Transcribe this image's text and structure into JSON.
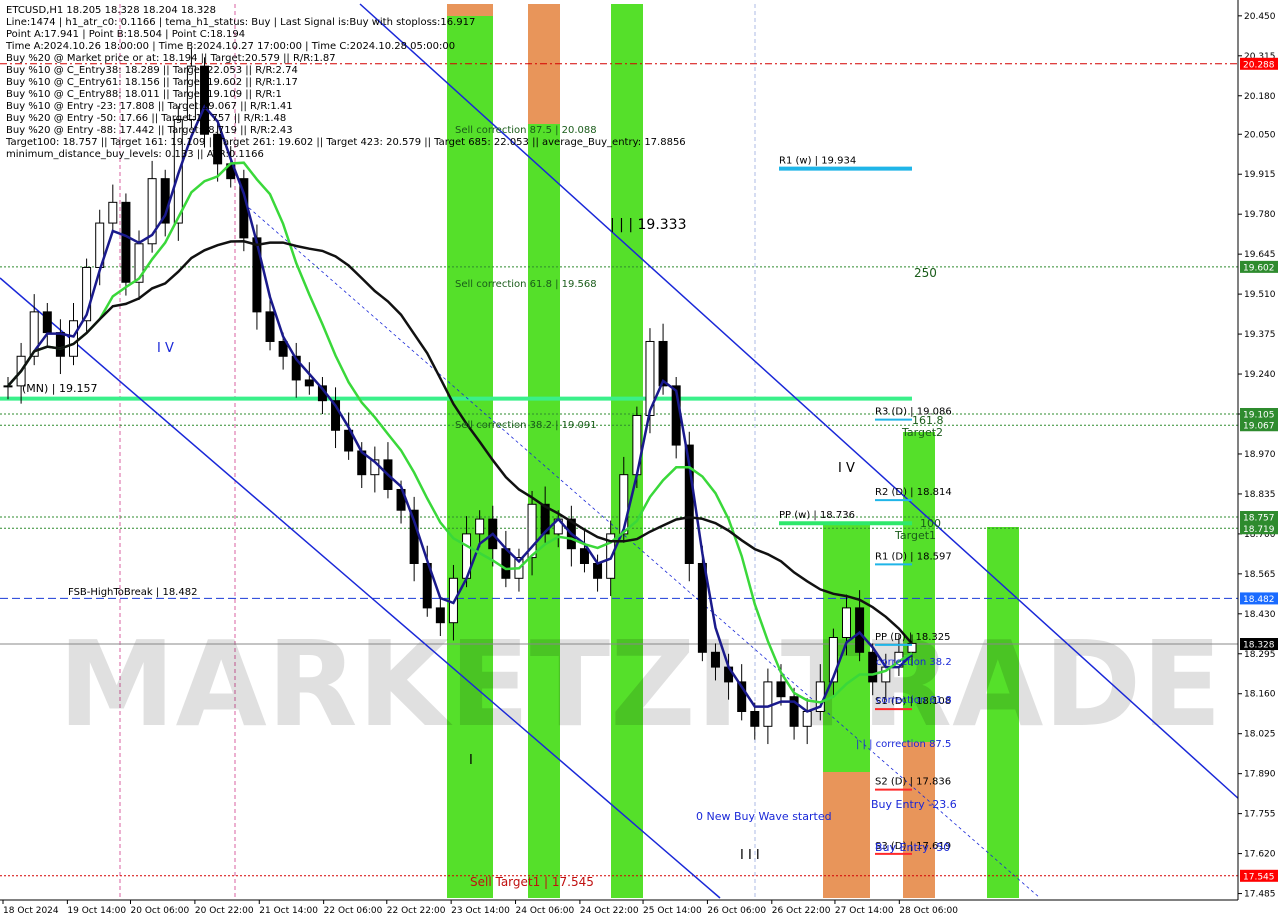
{
  "header": {
    "lines": [
      "ETCUSD,H1  18.205 18.328 18.204 18.328",
      "Line:1474  |  h1_atr_c0: 0.1166  |  tema_h1_status: Buy  |  Last Signal is:Buy with stoploss:16.917",
      "Point A:17.941  |  Point B:18.504  |  Point C:18.194",
      "Time A:2024.10.26 18:00:00  |  Time B:2024.10.27 17:00:00  |  Time C:2024.10.28 05:00:00",
      "Buy %20 @ Market price or at: 18.194  ||  Target:20.579  ||  R/R:1.87",
      "Buy %10 @ C_Entry38: 18.289  ||  Target:22.053  ||  R/R:2.74",
      "Buy %10 @ C_Entry61: 18.156  ||  Target:19.602  ||  R/R:1.17",
      "Buy %10 @ C_Entry88: 18.011  ||  Target:19.109  ||  R/R:1",
      "Buy %10 @ Entry -23: 17.808  ||  Target:19.067  ||  R/R:1.41",
      "Buy %20 @ Entry -50: 17.66  ||  Target:18.757  ||  R/R:1.48",
      "Buy %20 @ Entry -88: 17.442  ||  Target:18.719  ||  R/R:2.43",
      "Target100: 18.757  ||  Target 161: 19.109  ||  Target 261: 19.602  ||  Target 423: 20.579  ||  Target 685: 22.053  ||  average_Buy_entry: 17.8856",
      "minimum_distance_buy_levels: 0.133  ||  ATR:0.1166"
    ]
  },
  "chart_data": {
    "type": "candlestick",
    "symbol": "ETCUSD",
    "timeframe": "H1",
    "ohlc_last": {
      "open": 18.205,
      "high": 18.328,
      "low": 18.204,
      "close": 18.328
    },
    "ylim": [
      17.47,
      20.49
    ],
    "y_ticks": [
      20.45,
      20.315,
      20.18,
      20.05,
      19.915,
      19.78,
      19.645,
      19.51,
      19.375,
      19.24,
      19.105,
      18.97,
      18.835,
      18.7,
      18.565,
      18.43,
      18.295,
      18.16,
      18.025,
      17.89,
      17.755,
      17.62,
      17.485
    ],
    "y_tick_labels": [
      "20.450",
      "20.315",
      "20.180",
      "20.050",
      "19.915",
      "19.780",
      "19.645",
      "19.510",
      "19.375",
      "19.240",
      "19.105",
      "18.970",
      "18.835",
      "18.700",
      "18.565",
      "18.430",
      "18.295",
      "18.160",
      "18.025",
      "17.890",
      "17.755",
      "17.620",
      "17.485"
    ],
    "x_labels": [
      "18 Oct 2024",
      "19 Oct 14:00",
      "20 Oct 06:00",
      "20 Oct 22:00",
      "21 Oct 14:00",
      "22 Oct 06:00",
      "22 Oct 22:00",
      "23 Oct 14:00",
      "24 Oct 06:00",
      "24 Oct 22:00",
      "25 Oct 14:00",
      "26 Oct 06:00",
      "26 Oct 22:00",
      "27 Oct 14:00",
      "28 Oct 06:00"
    ],
    "x_label_frac": [
      0.0,
      0.052,
      0.103,
      0.155,
      0.207,
      0.259,
      0.31,
      0.362,
      0.414,
      0.466,
      0.517,
      0.569,
      0.621,
      0.672,
      0.724
    ],
    "close_series": [
      19.2,
      19.3,
      19.45,
      19.38,
      19.3,
      19.42,
      19.6,
      19.75,
      19.82,
      19.55,
      19.68,
      19.9,
      19.75,
      20.1,
      20.28,
      20.05,
      19.95,
      19.9,
      19.7,
      19.45,
      19.35,
      19.3,
      19.22,
      19.2,
      19.15,
      19.05,
      18.98,
      18.9,
      18.95,
      18.85,
      18.78,
      18.6,
      18.45,
      18.4,
      18.55,
      18.7,
      18.75,
      18.65,
      18.55,
      18.62,
      18.8,
      18.7,
      18.75,
      18.65,
      18.6,
      18.55,
      18.7,
      18.9,
      19.1,
      19.35,
      19.2,
      19.0,
      18.6,
      18.3,
      18.25,
      18.2,
      18.1,
      18.05,
      18.2,
      18.15,
      18.05,
      18.1,
      18.2,
      18.35,
      18.45,
      18.3,
      18.2,
      18.25,
      18.3,
      18.33
    ],
    "price_tags": [
      {
        "value": 20.288,
        "label": "20.288",
        "color": "#ff0000"
      },
      {
        "value": 19.602,
        "label": "19.602",
        "color": "#2e8b2e"
      },
      {
        "value": 19.105,
        "label": "19.105",
        "color": "#2e8b2e"
      },
      {
        "value": 19.067,
        "label": "19.067",
        "color": "#2e8b2e"
      },
      {
        "value": 18.757,
        "label": "18.757",
        "color": "#2e8b2e"
      },
      {
        "value": 18.719,
        "label": "18.719",
        "color": "#2e8b2e"
      },
      {
        "value": 18.482,
        "label": "18.482",
        "color": "#1a6bff"
      },
      {
        "value": 18.328,
        "label": "18.328",
        "color": "#000000"
      },
      {
        "value": 17.545,
        "label": "17.545",
        "color": "#ff0000"
      }
    ],
    "pivots": [
      {
        "label": "R1 (w) | 19.934",
        "value": 19.934,
        "color": "#1fb5e8"
      },
      {
        "label": "R3 (D) | 19.086",
        "value": 19.086,
        "color": "#1fb5e8"
      },
      {
        "label": "R2 (D) | 18.814",
        "value": 18.814,
        "color": "#1fb5e8"
      },
      {
        "label": "PP (w) | 18.736",
        "value": 18.736,
        "color": "#2ee86a"
      },
      {
        "label": "R1 (D) | 18.597",
        "value": 18.597,
        "color": "#1fb5e8"
      },
      {
        "label": "PP (D) | 18.325",
        "value": 18.325,
        "color": "#1fb5e8"
      },
      {
        "label": "S1 (D) | 18.108",
        "value": 18.108,
        "color": "#ff2a2a"
      },
      {
        "label": "S2 (D) | 17.836",
        "value": 17.836,
        "color": "#ff2a2a"
      },
      {
        "label": "S3 (D) | 17.619",
        "value": 17.619,
        "color": "#ff2a2a"
      }
    ],
    "annotations": {
      "sell_corr_875": "Sell correction 87.5 | 20.088",
      "sell_corr_618": "Sell correction 61.8 | 19.568",
      "sell_corr_382": "Sell correction 38.2 | 19.091",
      "iii_19333": "| | | 19.333",
      "fsb": "FSB-HighToBreak | 18.482",
      "mn": "(MN) | 19.157",
      "sell_target1": "Sell Target1 | 17.545",
      "new_buy_wave": "0 New Buy Wave started",
      "buy_entry_236": "Buy Entry -23.6",
      "buy_entry_50": "Buy Entry -50",
      "correction_382": "correction 38.2",
      "correction_618": "correction 61.8",
      "correction_875": "| | | correction 87.5",
      "target2": "Target2",
      "target1": "Target1",
      "t1618": "161.8",
      "t100": "100",
      "t250": "250",
      "wave_iv_1": "I V",
      "wave_iv_2": "I V",
      "wave_iii": "I I I",
      "wave_i": "I"
    },
    "watermark": "MARKETZI TRADE"
  }
}
